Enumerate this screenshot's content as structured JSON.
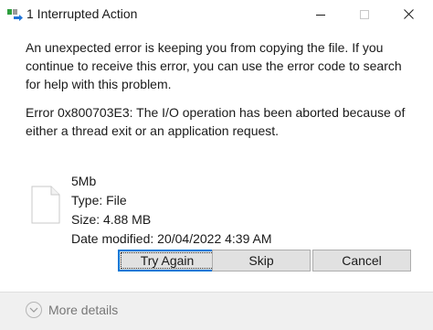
{
  "window": {
    "title": "1 Interrupted Action",
    "icon": "file-transfer-icon"
  },
  "dialog": {
    "message": "An unexpected error is keeping you from copying the file. If you continue to receive this error, you can use the error code to search for help with this problem.",
    "error": "Error 0x800703E3: The I/O operation has been aborted because of either a thread exit or an application request."
  },
  "file": {
    "name": "5Mb",
    "type": "Type: File",
    "size": "Size: 4.88 MB",
    "modified": "Date modified: 20/04/2022 4:39 AM"
  },
  "buttons": {
    "try_again": "Try Again",
    "skip": "Skip",
    "cancel": "Cancel"
  },
  "footer": {
    "more_details": "More details"
  },
  "colors": {
    "accent": "#0078d7",
    "button_bg": "#e1e1e1",
    "footer_bg": "#f0f0f0"
  }
}
